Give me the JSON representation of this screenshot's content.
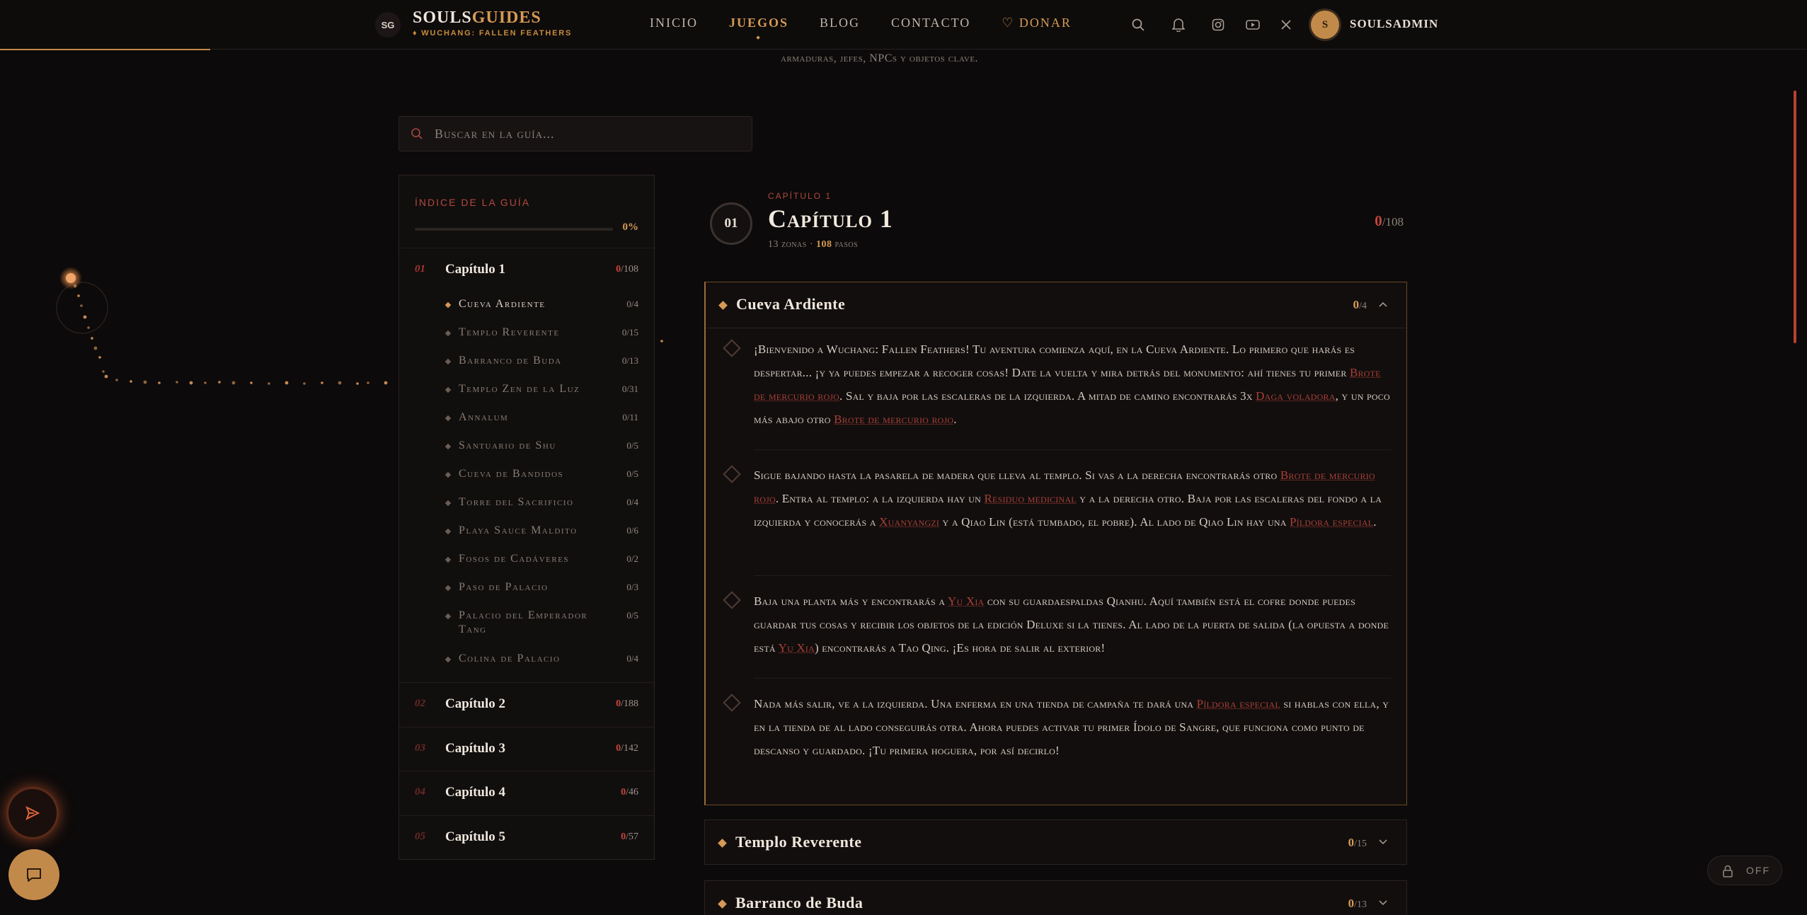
{
  "header": {
    "logo_badge": "SG",
    "logo_title_a": "SOULS",
    "logo_title_b": "GUIDES",
    "logo_sub": "♦ WUCHANG: FALLEN FEATHERS",
    "nav": [
      "INICIO",
      "JUEGOS",
      "BLOG",
      "CONTACTO"
    ],
    "nav_active": "JUEGOS",
    "donate": "♡ DONAR",
    "icons": [
      "search-icon",
      "bell-icon",
      "instagram-icon",
      "youtube-icon",
      "x-icon"
    ],
    "avatar_initial": "S",
    "username": "SOULSADMIN",
    "accent_color": "#d59a55",
    "read_progress": 0.116
  },
  "page_subtitle": "armaduras, jefes, NPCs y objetos clave.",
  "search": {
    "placeholder": "Buscar en la guía..."
  },
  "sidebar": {
    "title": "ÍNDICE DE LA GUÍA",
    "progress_pct": "0%",
    "progress_value": 0,
    "chapter1": {
      "num": "01",
      "label": "Capítulo 1",
      "done": "0",
      "total": "/108"
    },
    "zones": [
      {
        "label": "Cueva Ardiente",
        "count": "0/4"
      },
      {
        "label": "Templo Reverente",
        "count": "0/15"
      },
      {
        "label": "Barranco de Buda",
        "count": "0/13"
      },
      {
        "label": "Templo Zen de la Luz",
        "count": "0/31"
      },
      {
        "label": "Annalum",
        "count": "0/11"
      },
      {
        "label": "Santuario de Shu",
        "count": "0/5"
      },
      {
        "label": "Cueva de Bandidos",
        "count": "0/5"
      },
      {
        "label": "Torre del Sacrificio",
        "count": "0/4"
      },
      {
        "label": "Playa Sauce Maldito",
        "count": "0/6"
      },
      {
        "label": "Fosos de Cadáveres",
        "count": "0/2"
      },
      {
        "label": "Paso de Palacio",
        "count": "0/3"
      },
      {
        "label": "Palacio del Emperador Tang",
        "count": "0/5"
      },
      {
        "label": "Colina de Palacio",
        "count": "0/4"
      }
    ],
    "chapters": [
      {
        "num": "02",
        "label": "Capítulo 2",
        "done": "0",
        "total": "/188"
      },
      {
        "num": "03",
        "label": "Capítulo 3",
        "done": "0",
        "total": "/142"
      },
      {
        "num": "04",
        "label": "Capítulo 4",
        "done": "0",
        "total": "/46"
      },
      {
        "num": "05",
        "label": "Capítulo 5",
        "done": "0",
        "total": "/57"
      }
    ]
  },
  "chapter": {
    "badge": "01",
    "kicker": "CAPÍTULO 1",
    "title": "Capítulo 1",
    "zones_text": "13 zonas · ",
    "steps_num": "108",
    "steps_text": " pasos",
    "done": "0",
    "total": "/108"
  },
  "open_zone": {
    "title": "Cueva Ardiente",
    "done": "0",
    "total": "/4",
    "steps": [
      [
        {
          "t": "¡Bienvenido a Wuchang: Fallen Feathers! Tu aventura comienza aquí, en la Cueva Ardiente. Lo primero que harás es despertar... ¡y ya puedes empezar a recoger cosas! Date la vuelta y mira detrás del monumento: ahí tienes tu primer "
        },
        {
          "l": "Brote de mercurio rojo"
        },
        {
          "t": ". Sal y baja por las escaleras de la izquierda. A mitad de camino encontrarás 3x "
        },
        {
          "l": "Daga voladora"
        },
        {
          "t": ", y un poco más abajo otro "
        },
        {
          "l": "Brote de mercurio rojo"
        },
        {
          "t": "."
        }
      ],
      [
        {
          "t": "Sigue bajando hasta la pasarela de madera que lleva al templo. Si vas a la derecha encontrarás otro "
        },
        {
          "l": "Brote de mercurio rojo"
        },
        {
          "t": ". Entra al templo: a la izquierda hay un "
        },
        {
          "l": "Residuo medicinal"
        },
        {
          "t": " y a la derecha otro. Baja por las escaleras del fondo a la izquierda y conocerás a "
        },
        {
          "l": "Xuanyangzi"
        },
        {
          "t": " y a Qiao Lin (está tumbado, el pobre). Al lado de Qiao Lin hay una "
        },
        {
          "l": "Píldora especial"
        },
        {
          "t": "."
        }
      ],
      [
        {
          "t": "Baja una planta más y encontrarás a "
        },
        {
          "l": "Yu Xia"
        },
        {
          "t": " con su guardaespaldas Qianhu. Aquí también está el cofre donde puedes guardar tus cosas y recibir los objetos de la edición Deluxe si la tienes. Al lado de la puerta de salida (la opuesta a donde está "
        },
        {
          "l": "Yu Xia"
        },
        {
          "t": ") encontrarás a Tao Qing. ¡Es hora de salir al exterior!"
        }
      ],
      [
        {
          "t": "Nada más salir, ve a la izquierda. Una enferma en una tienda de campaña te dará una "
        },
        {
          "l": "Píldora especial"
        },
        {
          "t": " si hablas con ella, y en la tienda de al lado conseguirás otra. Ahora puedes activar tu primer Ídolo de Sangre, que funciona como punto de descanso y guardado. ¡Tu primera hoguera, por así decirlo!"
        }
      ]
    ]
  },
  "closed_zones": [
    {
      "title": "Templo Reverente",
      "done": "0",
      "total": "/15"
    },
    {
      "title": "Barranco de Buda",
      "done": "0",
      "total": "/13"
    }
  ],
  "lock_toggle": "OFF"
}
